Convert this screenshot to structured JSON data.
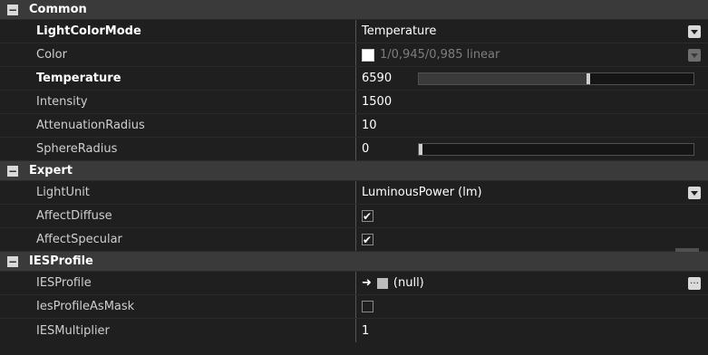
{
  "sections": {
    "common": {
      "title": "Common",
      "toggle": "−",
      "rows": {
        "lightColorMode": {
          "label": "LightColorMode",
          "value": "Temperature"
        },
        "color": {
          "label": "Color",
          "value": "1/0,945/0,985 linear"
        },
        "temperature": {
          "label": "Temperature",
          "value": "6590",
          "slider_fraction": 0.61
        },
        "intensity": {
          "label": "Intensity",
          "value": "1500"
        },
        "attenuationRadius": {
          "label": "AttenuationRadius",
          "value": "10"
        },
        "sphereRadius": {
          "label": "SphereRadius",
          "value": "0",
          "slider_fraction": 0.0
        }
      }
    },
    "expert": {
      "title": "Expert",
      "toggle": "−",
      "rows": {
        "lightUnit": {
          "label": "LightUnit",
          "value": "LuminousPower (lm)"
        },
        "affectDiffuse": {
          "label": "AffectDiffuse",
          "checked": true
        },
        "affectSpecular": {
          "label": "AffectSpecular",
          "checked": true
        }
      }
    },
    "iesProfile": {
      "title": "IESProfile",
      "toggle": "−",
      "rows": {
        "iesProfile": {
          "label": "IESProfile",
          "value": "(null)"
        },
        "iesProfileAsMask": {
          "label": "IesProfileAsMask",
          "checked": false
        },
        "iesMultiplier": {
          "label": "IESMultiplier",
          "value": "1"
        }
      }
    }
  },
  "colors": {
    "background": "#1f1f1f",
    "section_background": "#3a3a3a",
    "text": "#e6e6e6",
    "disabled_text": "#7d7d7d"
  },
  "icons": {
    "section_toggle": "collapse-icon",
    "dropdown": "chevron-down-icon",
    "asset_link": "arrow-right-icon",
    "asset": "asset-icon",
    "browse": "ellipsis-icon"
  }
}
